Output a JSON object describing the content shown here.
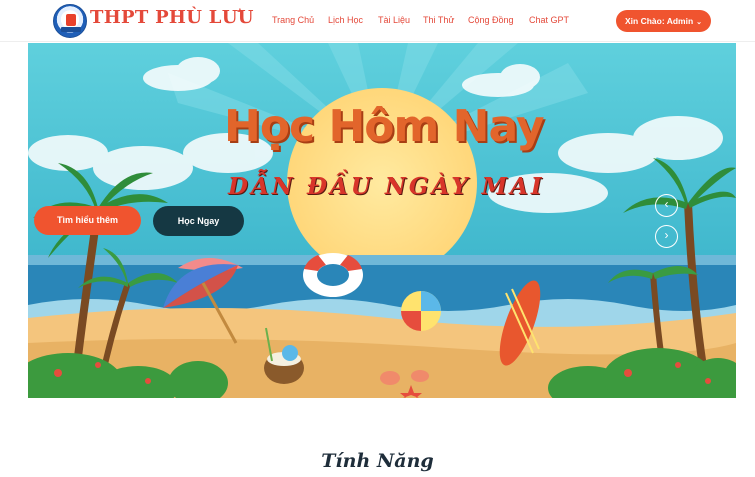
{
  "header": {
    "brand": "THPT PHÙ LƯU",
    "nav": [
      {
        "label": "Trang Chủ"
      },
      {
        "label": "Lịch Học"
      },
      {
        "label": "Tài Liệu"
      },
      {
        "label": "Thi Thử"
      },
      {
        "label": "Cộng Đồng"
      },
      {
        "label": "Chat GPT"
      }
    ],
    "account_label": "Xin Chào: Admin"
  },
  "hero": {
    "title": "Học Hôm Nay",
    "subtitle": "DẪN ĐẦU NGÀY MAI",
    "learn_more": "Tìm hiểu thêm",
    "study_now": "Học Ngay"
  },
  "features": {
    "title": "Tính Năng"
  },
  "colors": {
    "accent": "#f0542f",
    "dark_button": "#153843",
    "sky": "#4cc4d4",
    "sea": "#2a86b8",
    "sand": "#f4c57d"
  }
}
